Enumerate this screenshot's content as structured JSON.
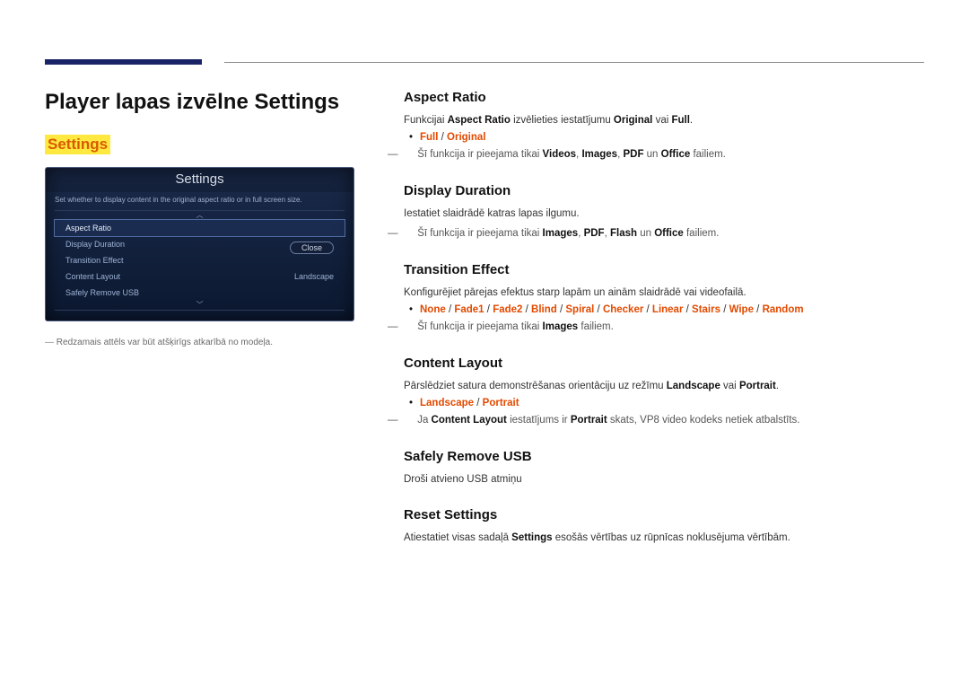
{
  "page_title": "Player lapas izvēlne Settings",
  "highlighted_word": "Settings",
  "panel": {
    "title": "Settings",
    "help": "Set whether to display content in the original aspect ratio or in full screen size.",
    "rows": [
      {
        "label": "Aspect Ratio",
        "value": "",
        "selected": true
      },
      {
        "label": "Display Duration",
        "value": ""
      },
      {
        "label": "Transition Effect",
        "value": ""
      },
      {
        "label": "Content Layout",
        "value": "Landscape"
      },
      {
        "label": "Safely Remove USB",
        "value": ""
      }
    ],
    "close_label": "Close"
  },
  "image_note": "Redzamais attēls var būt atšķirīgs atkarībā no modeļa.",
  "sections": {
    "aspect_ratio": {
      "heading": "Aspect Ratio",
      "p1a": "Funkcijai ",
      "p1b": " izvēlieties iestatījumu ",
      "p1c": " vai ",
      "bullet": "Full / Original",
      "note_a": "Šī funkcija ir pieejama tikai ",
      "note_t1": "Videos",
      "note_t2": "Images",
      "note_t3": "PDF",
      "note_t4": "Office",
      "note_b": " failiem."
    },
    "display_duration": {
      "heading": "Display Duration",
      "p": "Iestatiet slaidrādē katras lapas ilgumu.",
      "note_a": "Šī funkcija ir pieejama tikai ",
      "note_t1": "Images",
      "note_t2": "PDF",
      "note_t3": "Flash",
      "note_t4": "Office",
      "note_b": " failiem."
    },
    "transition": {
      "heading": "Transition Effect",
      "p": "Konfigurējiet pārejas efektus starp lapām un ainām slaidrādē vai videofailā.",
      "bullet": "None / Fade1 / Fade2 / Blind / Spiral / Checker / Linear / Stairs / Wipe / Random",
      "note_a": "Šī funkcija ir pieejama tikai ",
      "note_t": "Images",
      "note_b": " failiem."
    },
    "content_layout": {
      "heading": "Content Layout",
      "p_a": "Pārslēdziet satura demonstrēšanas orientāciju uz režīmu ",
      "p_t1": "Landscape",
      "p_mid": " vai ",
      "p_t2": "Portrait",
      "bullet": "Landscape / Portrait",
      "note_a": "Ja ",
      "note_t1": "Content Layout",
      "note_mid": " iestatījums ir ",
      "note_t2": "Portrait",
      "note_b": " skats, VP8 video kodeks netiek atbalstīts."
    },
    "safely_remove": {
      "heading": "Safely Remove USB",
      "p": "Droši atvieno USB atmiņu"
    },
    "reset": {
      "heading": "Reset Settings",
      "p_a": "Atiestatiet visas sadaļā ",
      "p_t": "Settings",
      "p_b": " esošās vērtības uz rūpnīcas noklusējuma vērtībām."
    }
  }
}
